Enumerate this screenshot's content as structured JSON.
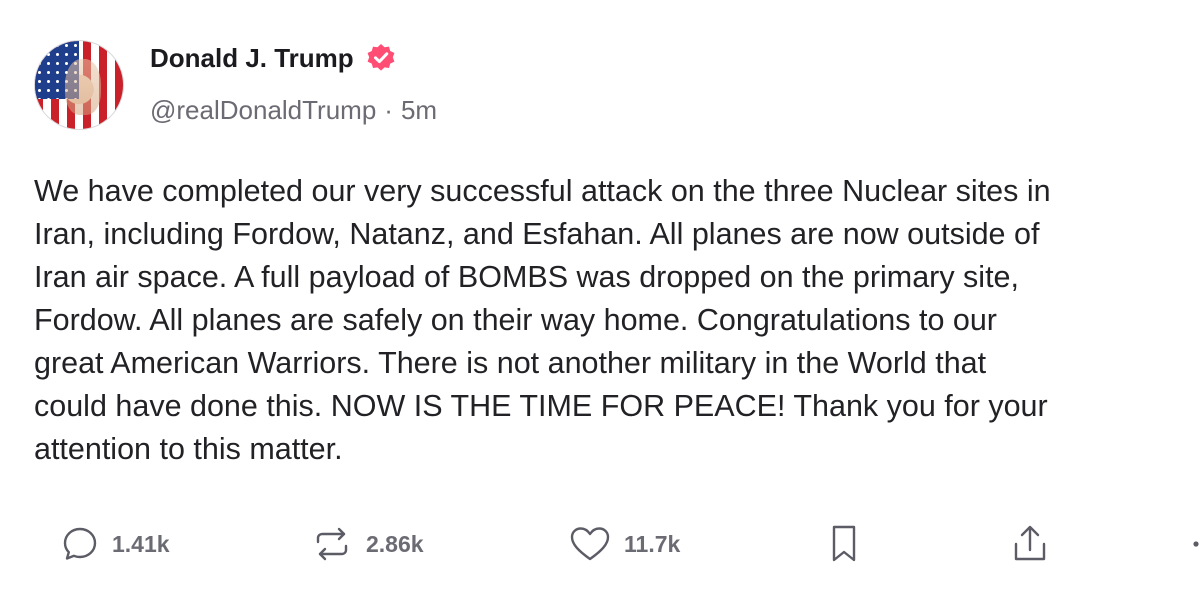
{
  "author": {
    "display_name": "Donald J. Trump",
    "handle": "@realDonaldTrump",
    "separator": "·",
    "time": "5m",
    "verified_badge_color": "#ff4d74",
    "avatar_icon": "american-flag-portrait"
  },
  "post": {
    "lines": [
      "We have completed our very successful attack on the three Nuclear sites in",
      "Iran, including Fordow, Natanz, and Esfahan. All planes are now outside of",
      "Iran air space. A full payload of BOMBS was dropped on the primary site,",
      "Fordow. All planes are safely on their way home. Congratulations to our",
      "great American Warriors. There is not another military in the World that",
      "could have done this. NOW IS THE TIME FOR PEACE! Thank you for your",
      "attention to this matter."
    ]
  },
  "actions": {
    "replies": {
      "icon": "reply-bubble-icon",
      "count": "1.41k"
    },
    "reposts": {
      "icon": "repost-icon",
      "count": "2.86k"
    },
    "likes": {
      "icon": "heart-icon",
      "count": "11.7k"
    },
    "bookmark": {
      "icon": "bookmark-icon"
    },
    "share": {
      "icon": "share-icon"
    }
  }
}
